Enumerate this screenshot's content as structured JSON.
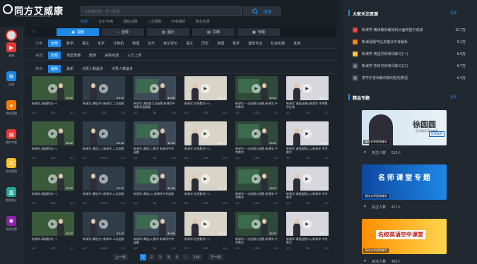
{
  "header": {
    "logo": "同方艾威康",
    "logo_sub": "TNTF·AVCEDIGITAL",
    "search_placeholder": "大家都在搜：学习资源",
    "search_label": "搜索",
    "hot_label": "热搜:",
    "hot": [
      "2017中考",
      "模拟试题",
      "二次函数",
      "中考解析",
      "职业资源"
    ]
  },
  "sidebar": [
    {
      "label": "同方AI",
      "icon": "avatar-icon"
    },
    {
      "label": "直播",
      "icon": "live-icon",
      "color": "#e53935"
    },
    {
      "label": "资源",
      "icon": "resource-icon",
      "color": "#1e88e5"
    },
    {
      "label": "我的直播",
      "icon": "my-live-icon",
      "color": "#f57c00"
    },
    {
      "label": "我的专题",
      "icon": "topic-icon",
      "color": "#e53935"
    },
    {
      "label": "任务管理",
      "icon": "task-icon",
      "color": "#fbc02d"
    },
    {
      "label": "数据统计",
      "icon": "stats-icon",
      "color": "#26a69a"
    },
    {
      "label": "系统设置",
      "icon": "settings-icon",
      "color": "#8e24aa"
    }
  ],
  "tabs": [
    {
      "label": "视频",
      "active": true
    },
    {
      "label": "音频"
    },
    {
      "label": "图片"
    },
    {
      "label": "文档"
    },
    {
      "label": "专题"
    }
  ],
  "filters": {
    "subject_label": "分类:",
    "subjects": [
      "全部",
      "数学",
      "语文",
      "化学",
      "计算机",
      "物理",
      "音乐",
      "考试评价",
      "语文",
      "历史",
      "地理",
      "哲学",
      "建筑专业",
      "社会实践",
      "其他"
    ],
    "source_label": "来源:",
    "sources": [
      "全部",
      "课堂录播",
      "微课",
      "采购资源",
      "三方上传"
    ],
    "sort_label": "排序:",
    "sorts": [
      "最热",
      "最新",
      "点赞人数最多",
      "点赞人数最多"
    ]
  },
  "videos": [
    {
      "dur": "45:22",
      "title": "新课学-高级数学(一)",
      "a": "1/2",
      "b": "120",
      "c": "5.2"
    },
    {
      "dur": "33:12",
      "title": "新课学-课程(中)\n新课学-二次函数",
      "a": "1/2",
      "b": "121",
      "c": "5.2"
    },
    {
      "dur": "44:08",
      "title": "新课学-课程练习及函数\n新课学中考数学函数题",
      "a": "1/2",
      "b": "80",
      "c": "9.3"
    },
    {
      "dur": "45:10",
      "title": "新课学-在线数学(一)",
      "a": "3/2",
      "b": "432",
      "c": "8.3"
    },
    {
      "dur": "43:11",
      "title": "新课学-一次函数与函数\n新课学-中考数学",
      "a": "1/1",
      "b": "3,111",
      "c": "1.2"
    },
    {
      "dur": "45:12",
      "title": "新课学-课程(函数)\n新课学-中考数学在线",
      "a": "1/2",
      "b": "1/2",
      "c": "1.2"
    },
    {
      "dur": "45:22",
      "title": "新课学-高级数学(一)",
      "a": "1/2",
      "b": "120",
      "c": "5.2"
    },
    {
      "dur": "43:15",
      "title": "新课学-课程(二)\n新课学-二次函数",
      "a": "1/2",
      "b": "9,521",
      "c": "5.1"
    },
    {
      "dur": "44:08",
      "title": "新课学-课程(二)数学\n新课学中考函数",
      "a": "1/2",
      "b": "80",
      "c": "8.3"
    },
    {
      "dur": "45:10",
      "title": "新课学-在线数学(一)",
      "a": "3/2",
      "b": "432",
      "c": "8.3"
    },
    {
      "dur": "43:11",
      "title": "新课学-一次函数与函数\n新课学-中考数学",
      "a": "1/1",
      "b": "3,111",
      "c": "1.2"
    },
    {
      "dur": "45:12",
      "title": "新课学-课程函数(二)\n新课学-中考数学",
      "a": "1/2",
      "b": "1/2",
      "c": "1.2"
    },
    {
      "dur": "45:22",
      "title": "新课学-高级数学(一)",
      "a": "1/2",
      "b": "120",
      "c": "5.2"
    },
    {
      "dur": "43:12",
      "title": "新课学-课程(中)\n新课学-二次函数",
      "a": "1/2",
      "b": "9,521",
      "c": "5.1"
    },
    {
      "dur": "44:08",
      "title": "新课学-课程(二)\n新课学中考函数",
      "a": "1/2",
      "b": "80",
      "c": "9.3"
    },
    {
      "dur": "45:10",
      "title": "新课学-在线数学(一)",
      "a": "3/2",
      "b": "432",
      "c": "8.3"
    },
    {
      "dur": "43:11",
      "title": "新课学-一次函数与函数\n新课学-中考数学",
      "a": "1/1",
      "b": "3,111",
      "c": "1.2"
    },
    {
      "dur": "45:12",
      "title": "新课学-课程函数(二)\n新课学-中考数学",
      "a": "1/2",
      "b": "1/2",
      "c": "1.2"
    },
    {
      "dur": "45:22",
      "title": "新课学-高级数学(一)",
      "a": "1/2",
      "b": "120",
      "c": "5.2"
    },
    {
      "dur": "43:13",
      "title": "新课学-课程(中)\n新课学-二次函数",
      "a": "1/2",
      "b": "9,521",
      "c": "5.1"
    },
    {
      "dur": "44:08",
      "title": "新课学-课程(二)数学\n新课学中考函数",
      "a": "1/2",
      "b": "80",
      "c": "8.3"
    },
    {
      "dur": "45:10",
      "title": "新课学-在线数学(一)",
      "a": "3/2",
      "b": "432",
      "c": "8.3"
    },
    {
      "dur": "42:52",
      "title": "新课学-一次函数与函数\n新课学-中考数学",
      "a": "1/1",
      "b": "3,111",
      "c": "1.2"
    },
    {
      "dur": "45:12",
      "title": "新课学-课程函数(二)\n新课学-中考数学",
      "a": "1/2",
      "b": "1/2",
      "c": "1.2"
    }
  ],
  "pagination": {
    "prev": "上一页",
    "pages": [
      "1",
      "2",
      "3",
      "4",
      "5",
      "...",
      "154"
    ],
    "next": "下一页"
  },
  "ranking": {
    "title": "大家关注资源",
    "more": "更多",
    "items": [
      {
        "n": "1",
        "t": "新课学-精讲教师教如何大面积提升成绩",
        "v": "10.7万",
        "color": "#e53935"
      },
      {
        "n": "2",
        "t": "新课话题气氛关键点中考解析",
        "v": "9.1万",
        "color": "#f57c00"
      },
      {
        "n": "3",
        "t": "新课学-英语并称单词练习(一)",
        "v": "8.9万",
        "color": "#fbc02d"
      },
      {
        "n": "4",
        "t": "新课学-项目并称单词练习(三)",
        "v": "8.7万",
        "color": "#5c6670"
      },
      {
        "n": "5",
        "t": "李学东老师教你如何轻松英语",
        "v": "6.4万",
        "color": "#5c6670"
      }
    ]
  },
  "topics": {
    "title": "精品专题",
    "more": "更多",
    "items": [
      {
        "name": "徐圆圆",
        "sub": "初中数学英语教师",
        "badge": "优质推荐",
        "caption": "高校名师视频辅导",
        "likes": "关注人数",
        "count": "512人"
      },
      {
        "name": "名 师 课 堂 专 题",
        "caption": "高校名师视频辅导",
        "likes": "关注人数",
        "count": "471人"
      },
      {
        "name": "名校英语空中课堂",
        "caption": "高校名师视频辅导",
        "likes": "关注人数",
        "count": "433人"
      }
    ]
  }
}
